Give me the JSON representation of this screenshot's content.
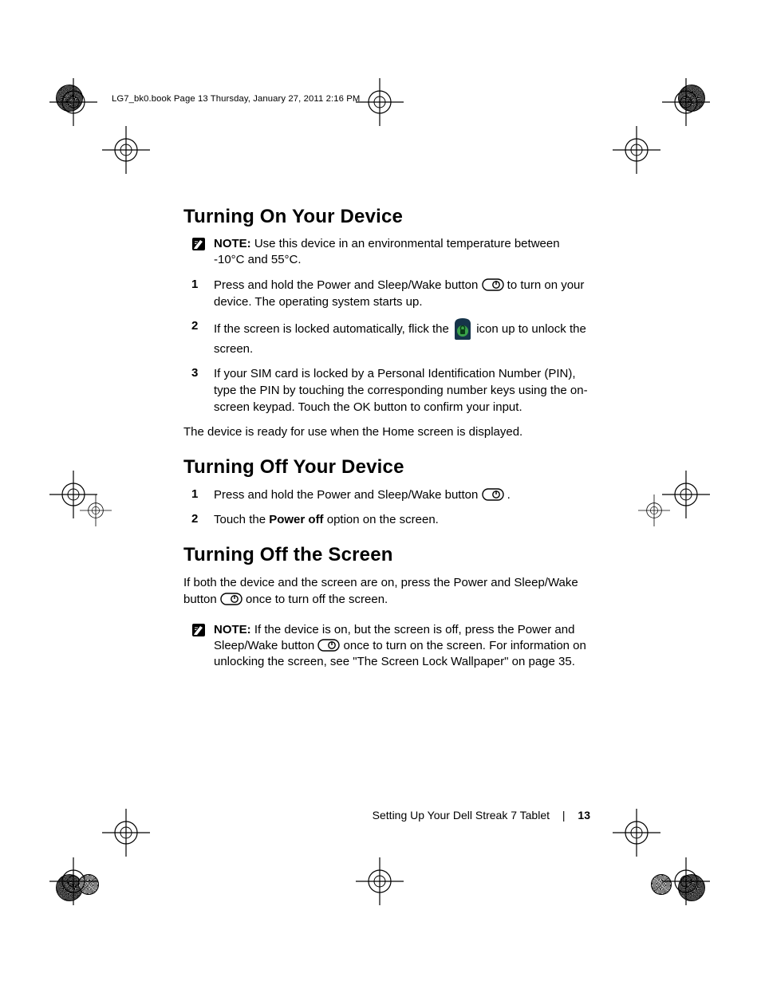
{
  "header": "LG7_bk0.book  Page 13  Thursday, January 27, 2011  2:16 PM",
  "section1": {
    "heading": "Turning On Your Device",
    "note_label": "NOTE:",
    "note_text": " Use this device in an environmental temperature between -10°C and 55°C.",
    "steps": {
      "s1_num": "1",
      "s1a": "Press and hold the Power and Sleep/Wake button ",
      "s1b": " to turn on your device. The operating system starts up.",
      "s2_num": "2",
      "s2a": "If the screen is locked automatically, flick the ",
      "s2b": " icon up to unlock the screen.",
      "s3_num": "3",
      "s3": "If your SIM card is locked by a Personal Identification Number (PIN), type the PIN by touching the corresponding number keys using the on-screen keypad. Touch the OK button to confirm your input."
    },
    "closing": "The device is ready for use when the Home screen is displayed."
  },
  "section2": {
    "heading": "Turning Off Your Device",
    "steps": {
      "s1_num": "1",
      "s1a": "Press and hold the Power and Sleep/Wake button ",
      "s1b": ".",
      "s2_num": "2",
      "s2a": "Touch the ",
      "s2_bold": "Power off",
      "s2b": " option on the screen."
    }
  },
  "section3": {
    "heading": "Turning Off the Screen",
    "para_a": "If both the device and the screen are on, press the Power and Sleep/Wake button ",
    "para_b": " once to turn off the screen.",
    "note_label": "NOTE:",
    "note_a": " If the device is on, but the screen is off, press the Power and Sleep/Wake button ",
    "note_b": " once to turn on the screen. For information on unlocking the screen, see \"The Screen Lock Wallpaper\" on page 35."
  },
  "footer": {
    "chapter": "Setting Up Your Dell Streak 7 Tablet",
    "page": "13"
  }
}
